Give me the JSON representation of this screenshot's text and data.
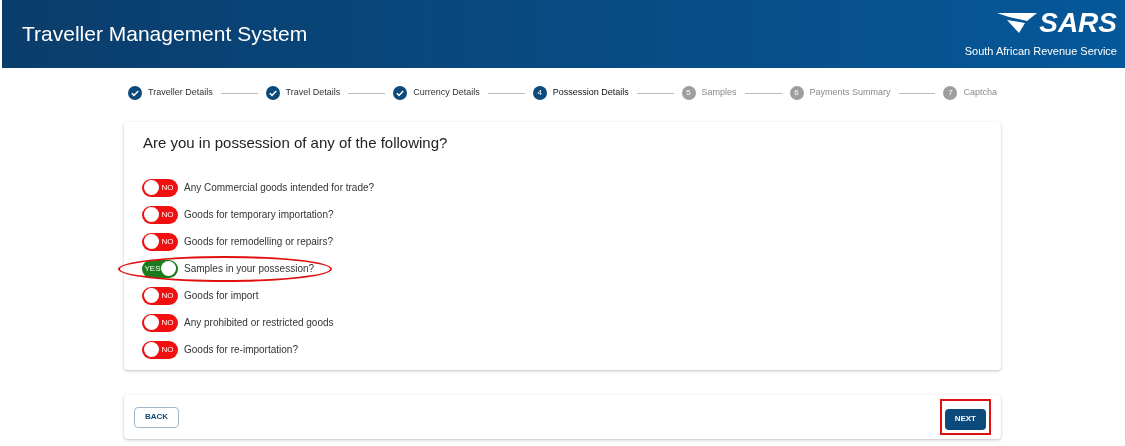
{
  "header": {
    "title": "Traveller Management System",
    "logo_text": "SARS",
    "logo_subtitle": "South African Revenue Service"
  },
  "steps": [
    {
      "label": "Traveller Details",
      "done": true,
      "selected": false
    },
    {
      "label": "Travel Details",
      "done": true,
      "selected": false
    },
    {
      "label": "Currency Details",
      "done": true,
      "selected": false
    },
    {
      "number": "4",
      "label": "Possession Details",
      "done": false,
      "selected": true
    },
    {
      "number": "5",
      "label": "Samples",
      "done": false,
      "selected": false
    },
    {
      "number": "6",
      "label": "Payments Summary",
      "done": false,
      "selected": false
    },
    {
      "number": "7",
      "label": "Captcha",
      "done": false,
      "selected": false
    }
  ],
  "question": "Are you in possession of any of the following?",
  "items": [
    {
      "label": "Any Commercial goods intended for trade?",
      "on": false,
      "toggle_text": "NO",
      "circled": false
    },
    {
      "label": "Goods for temporary importation?",
      "on": false,
      "toggle_text": "NO",
      "circled": false
    },
    {
      "label": "Goods for remodelling or repairs?",
      "on": false,
      "toggle_text": "NO",
      "circled": false
    },
    {
      "label": "Samples in your possession?",
      "on": true,
      "toggle_text": "YES",
      "circled": true
    },
    {
      "label": "Goods for import",
      "on": false,
      "toggle_text": "NO",
      "circled": false
    },
    {
      "label": "Any prohibited or restricted goods",
      "on": false,
      "toggle_text": "NO",
      "circled": false
    },
    {
      "label": "Goods for re-importation?",
      "on": false,
      "toggle_text": "NO",
      "circled": false
    }
  ],
  "buttons": {
    "back": "BACK",
    "next": "NEXT",
    "next_highlighted": true
  }
}
